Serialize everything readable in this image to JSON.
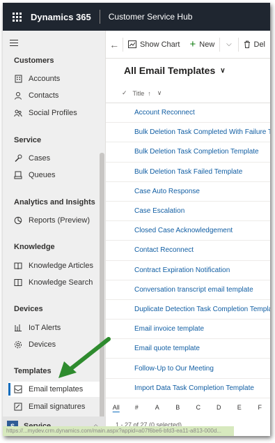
{
  "topbar": {
    "app_name": "Dynamics 365",
    "module_name": "Customer Service Hub"
  },
  "sidebar": {
    "groups": [
      {
        "label": "Customers",
        "items": [
          {
            "label": "Accounts",
            "icon": "building-icon"
          },
          {
            "label": "Contacts",
            "icon": "person-icon"
          },
          {
            "label": "Social Profiles",
            "icon": "social-icon"
          }
        ]
      },
      {
        "label": "Service",
        "items": [
          {
            "label": "Cases",
            "icon": "wrench-icon"
          },
          {
            "label": "Queues",
            "icon": "queue-icon"
          }
        ]
      },
      {
        "label": "Analytics and Insights",
        "items": [
          {
            "label": "Reports (Preview)",
            "icon": "reports-icon"
          }
        ]
      },
      {
        "label": "Knowledge",
        "items": [
          {
            "label": "Knowledge Articles",
            "icon": "book-icon"
          },
          {
            "label": "Knowledge Search",
            "icon": "book-search-icon"
          }
        ]
      },
      {
        "label": "Devices",
        "items": [
          {
            "label": "IoT Alerts",
            "icon": "iot-icon"
          },
          {
            "label": "Devices",
            "icon": "device-icon"
          }
        ]
      },
      {
        "label": "Templates",
        "items": [
          {
            "label": "Email templates",
            "icon": "email-template-icon",
            "selected": true
          },
          {
            "label": "Email signatures",
            "icon": "signature-icon"
          }
        ]
      }
    ],
    "area": {
      "avatar": "S",
      "label": "Service"
    }
  },
  "commandbar": {
    "show_chart": "Show Chart",
    "new": "New",
    "delete_partial": "Del"
  },
  "view": {
    "title": "All Email Templates",
    "column": "Title",
    "sort_indicator": "↑"
  },
  "rows": [
    "Account Reconnect",
    "Bulk Deletion Task Completed With Failure Te",
    "Bulk Deletion Task Completion Template",
    "Bulk Deletion Task Failed Template",
    "Case Auto Response",
    "Case Escalation",
    "Closed Case Acknowledgement",
    "Contact Reconnect",
    "Contract Expiration Notification",
    "Conversation transcript email template",
    "Duplicate Detection Task Completion Templat",
    "Email invoice template",
    "Email quote template",
    "Follow-Up to Our Meeting",
    "Import Data Task Completion Template"
  ],
  "jumpbar": [
    "All",
    "#",
    "A",
    "B",
    "C",
    "D",
    "E",
    "F"
  ],
  "footer": {
    "count": "1 - 27 of 27 (0 selected)"
  },
  "status_url": "https://...mydev.crm.dynamics.com/main.aspx?appid=a07f6be6-bfd3-ea11-a813-000d...",
  "colors": {
    "topbar": "#1f2630",
    "link": "#115ea3",
    "selected_marker": "#0f6cbd",
    "arrow": "#2e8b2e"
  }
}
